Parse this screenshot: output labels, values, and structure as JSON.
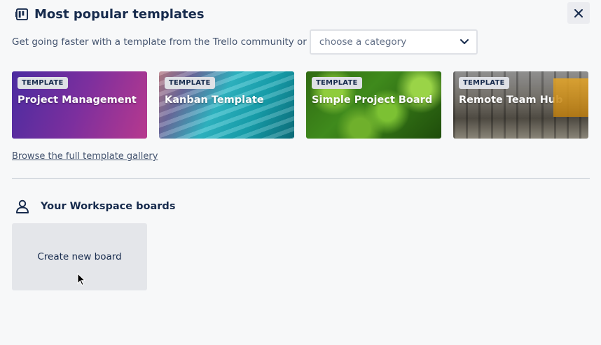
{
  "header": {
    "title": "Most popular templates",
    "icon": "board-template-icon"
  },
  "subtitle": "Get going faster with a template from the Trello community or",
  "category_select": {
    "value": "choose a category",
    "icon": "chevron-down-icon"
  },
  "templates": [
    {
      "badge": "TEMPLATE",
      "name": "Project Management"
    },
    {
      "badge": "TEMPLATE",
      "name": "Kanban Template"
    },
    {
      "badge": "TEMPLATE",
      "name": "Simple Project Board"
    },
    {
      "badge": "TEMPLATE",
      "name": "Remote Team Hub"
    }
  ],
  "browse_link": "Browse the full template gallery",
  "workspace": {
    "title": "Your Workspace boards",
    "icon": "person-icon",
    "create_label": "Create new board"
  },
  "colors": {
    "text": "#172b4d",
    "background": "#f7f8f9",
    "create_board_bg": "#e4e6ea"
  }
}
